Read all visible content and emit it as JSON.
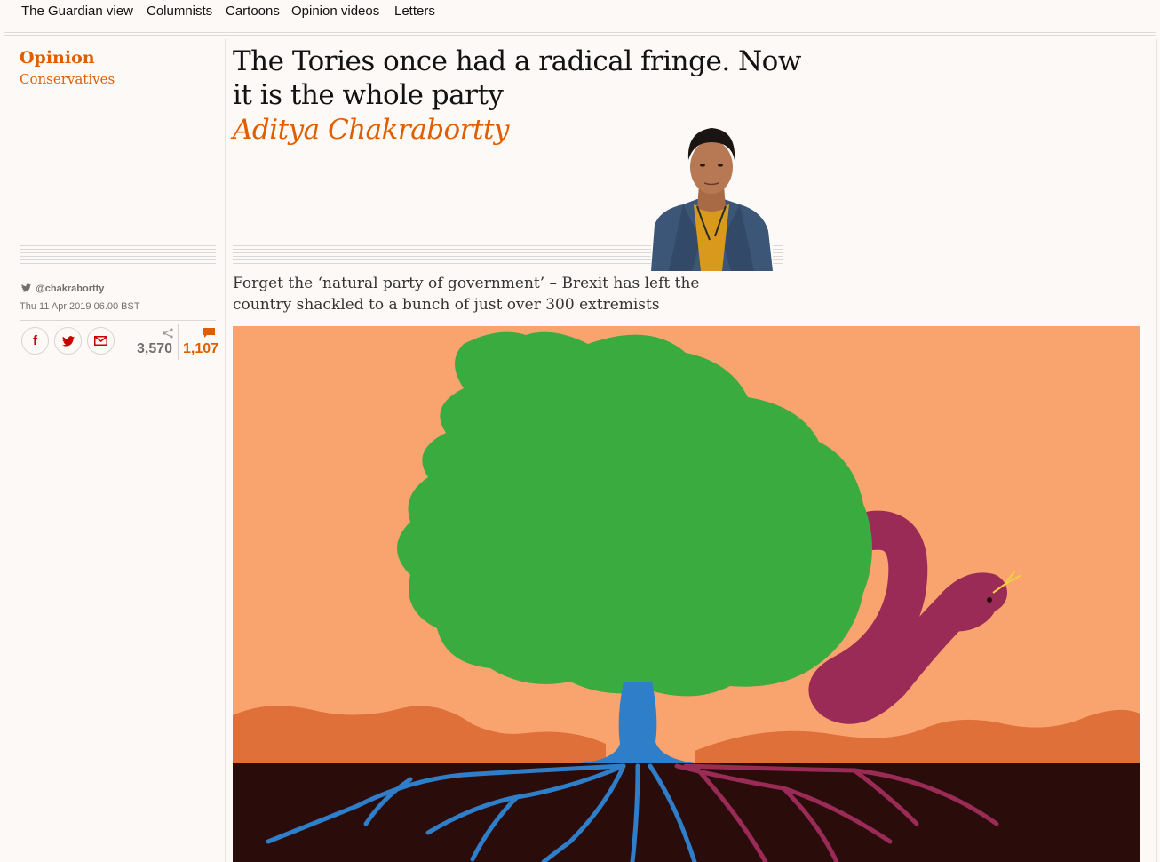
{
  "nav": {
    "items": [
      "The Guardian view",
      "Columnists",
      "Cartoons",
      "Opinion videos",
      "Letters"
    ]
  },
  "article": {
    "section": "Opinion",
    "series": "Conservatives",
    "headline": "The Tories once had a radical fringe. Now it is the whole party",
    "byline": "Aditya Chakrabortty",
    "standfirst": "Forget the ‘natural party of government’ – Brexit has left the country shackled to a bunch of just over 300 extremists",
    "twitter_handle": "@chakrabortty",
    "date": "Thu 11 Apr 2019 06.00 BST"
  },
  "share": {
    "facebook_glyph": "f",
    "share_count": "3,570",
    "comment_count": "1,107"
  },
  "colors": {
    "accent": "#e05e00",
    "background": "#fdf9f6",
    "sky": "#f9a36e",
    "tree": "#3aab3f",
    "trunk": "#2e7ec9",
    "snake": "#9a2a56",
    "hills": "#e07039",
    "ground": "#2a0d0b"
  },
  "icons": {
    "twitter": "twitter-bird-icon",
    "share": "share-icon",
    "comment": "comment-bubble-icon",
    "email": "envelope-icon"
  }
}
